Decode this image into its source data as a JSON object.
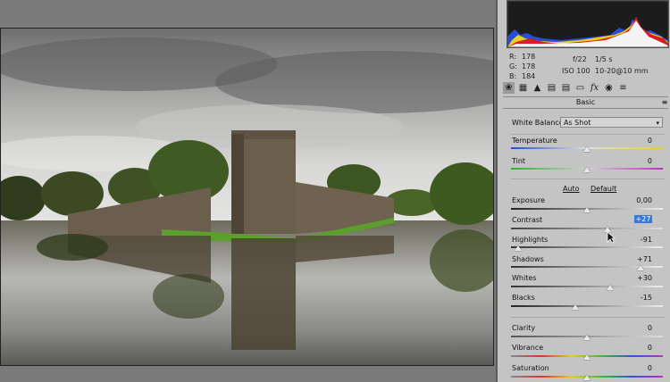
{
  "readout": {
    "r_label": "R:",
    "r_value": "178",
    "g_label": "G:",
    "g_value": "178",
    "b_label": "B:",
    "b_value": "184"
  },
  "exif": {
    "aperture": "f/22",
    "shutter": "1/5 s",
    "iso": "ISO 100",
    "lens": "10-20@10 mm"
  },
  "toolbar": {
    "tools": [
      "basic-icon",
      "tone-curve-icon",
      "detail-icon",
      "hsl-icon",
      "split-toning-icon",
      "lens-corrections-icon",
      "effects-fx-icon",
      "camera-calibration-icon",
      "presets-icon"
    ],
    "fx_label": "fx"
  },
  "section": {
    "title": "Basic"
  },
  "white_balance": {
    "label": "White Balance:",
    "value": "As Shot"
  },
  "sliders": {
    "temperature": {
      "label": "Temperature",
      "value": "0",
      "position": 0.5
    },
    "tint": {
      "label": "Tint",
      "value": "0",
      "position": 0.5
    },
    "exposure": {
      "label": "Exposure",
      "value": "0,00",
      "position": 0.5
    },
    "contrast": {
      "label": "Contrast",
      "value": "+27",
      "position": 0.635
    },
    "highlights": {
      "label": "Highlights",
      "value": "-91",
      "position": 0.045
    },
    "shadows": {
      "label": "Shadows",
      "value": "+71",
      "position": 0.855
    },
    "whites": {
      "label": "Whites",
      "value": "+30",
      "position": 0.65
    },
    "blacks": {
      "label": "Blacks",
      "value": "-15",
      "position": 0.425
    },
    "clarity": {
      "label": "Clarity",
      "value": "0",
      "position": 0.5
    },
    "vibrance": {
      "label": "Vibrance",
      "value": "0",
      "position": 0.5
    },
    "saturation": {
      "label": "Saturation",
      "value": "0",
      "position": 0.5
    }
  },
  "tone_links": {
    "auto": "Auto",
    "default": "Default"
  },
  "colors": {
    "panel_bg": "#c4c4c4",
    "selected_value_bg": "#3a78d8",
    "canvas_bg": "#7a7a7a"
  }
}
